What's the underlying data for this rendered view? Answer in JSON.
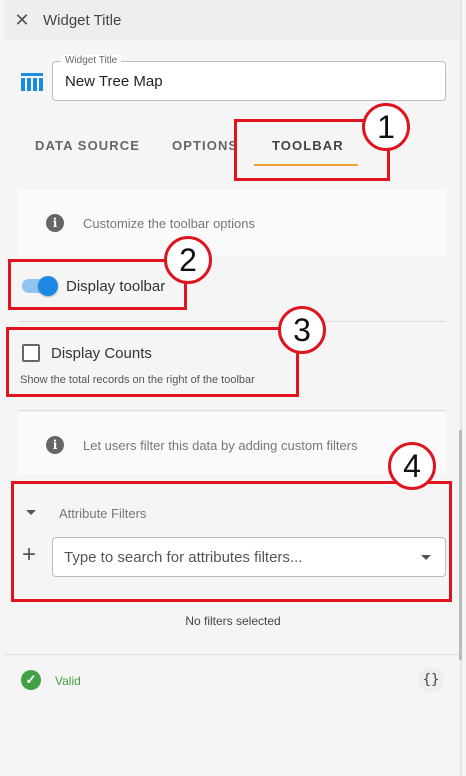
{
  "header": {
    "title": "Widget Title",
    "close_icon": "close-icon"
  },
  "title_field": {
    "legend": "Widget Title",
    "value": "New Tree Map",
    "icon": "treemap-icon"
  },
  "tabs": [
    {
      "label": "DATA SOURCE"
    },
    {
      "label": "OPTIONS"
    },
    {
      "label": "TOOLBAR",
      "active": true
    }
  ],
  "toolbar_info": "Customize the toolbar options",
  "display_toolbar": {
    "label": "Display toolbar",
    "enabled": true
  },
  "display_counts": {
    "label": "Display Counts",
    "help": "Show the total records on the right of the toolbar",
    "checked": false
  },
  "filters_info": "Let users filter this data by adding custom filters",
  "attribute_filters": {
    "label": "Attribute Filters",
    "plus": "+",
    "placeholder": "Type to search for attributes filters...",
    "empty": "No filters selected"
  },
  "footer": {
    "status": "Valid",
    "json_button": "{}"
  },
  "annotations": [
    "1",
    "2",
    "3",
    "4"
  ],
  "colors": {
    "accent": "#f0a030",
    "toggle": "#1e88e5",
    "valid": "#43a047",
    "annotation": "#e0141e"
  }
}
